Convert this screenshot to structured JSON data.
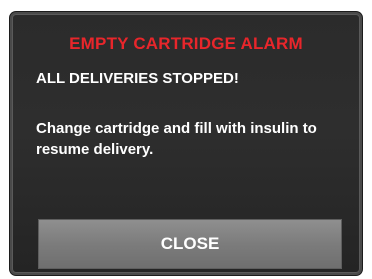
{
  "alarm": {
    "title": "EMPTY CARTRIDGE ALARM",
    "subtitle": "ALL DELIVERIES STOPPED!",
    "message": "Change cartridge and fill with insulin to resume delivery.",
    "close_label": "CLOSE"
  },
  "colors": {
    "title": "#e8262b",
    "text": "#ffffff",
    "background": "#2b2b2b",
    "button": "#7c7c7c"
  }
}
